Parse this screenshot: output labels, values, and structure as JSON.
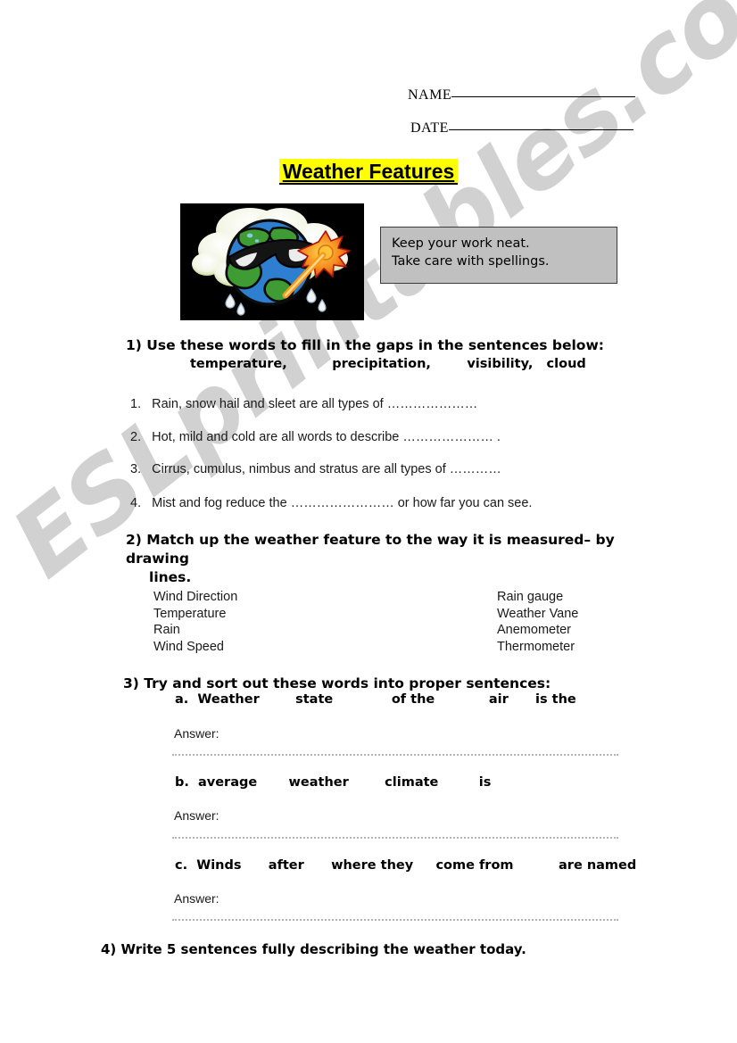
{
  "header": {
    "name_label": "NAME",
    "date_label": "DATE"
  },
  "title": "Weather Features",
  "clipart": {
    "alt": "earth-with-sunglasses-clouds-sun-rain"
  },
  "note_box": {
    "line1": "Keep your work neat.",
    "line2": "Take care with spellings."
  },
  "q1": {
    "heading": "1)  Use these words to fill in the gaps in the sentences below:",
    "wordbank": "temperature,          precipitation,        visibility,   cloud",
    "items": [
      {
        "num": "1.",
        "text": "Rain, snow hail and sleet are all types of …………………"
      },
      {
        "num": "2.",
        "text": "Hot, mild and cold are all words to describe ………………… ."
      },
      {
        "num": "3.",
        "text": "Cirrus, cumulus, nimbus and stratus are all types of …………"
      },
      {
        "num": "4.",
        "text": " Mist and fog reduce the …………………… or how far you can see."
      }
    ]
  },
  "q2": {
    "heading_line1": "2)  Match up the weather feature to the way it is measured– by drawing",
    "heading_line2": "lines.",
    "left_column": [
      "Wind Direction",
      "Temperature",
      "Rain",
      "Wind Speed"
    ],
    "right_column": [
      "Rain gauge",
      "Weather Vane",
      "Anemometer",
      "Thermometer"
    ]
  },
  "q3": {
    "heading": "3) Try and sort out these words into proper sentences:",
    "items": [
      {
        "label": "a.  Weather        state             of the            air      is the",
        "answer_label": "Answer:"
      },
      {
        "label": "b.  average       weather        climate         is",
        "answer_label": "Answer:"
      },
      {
        "label": "c.  Winds      after      where they     come from          are named",
        "answer_label": "Answer:"
      }
    ]
  },
  "q4": {
    "heading": "4) Write  5  sentences fully describing the weather today."
  },
  "watermark": {
    "text": "ESLprintables.com"
  },
  "colors": {
    "highlight": "#ffff00",
    "note_bg": "#c0c0c0",
    "clipart_bg": "#000000",
    "watermark": "#c9c9c9"
  }
}
